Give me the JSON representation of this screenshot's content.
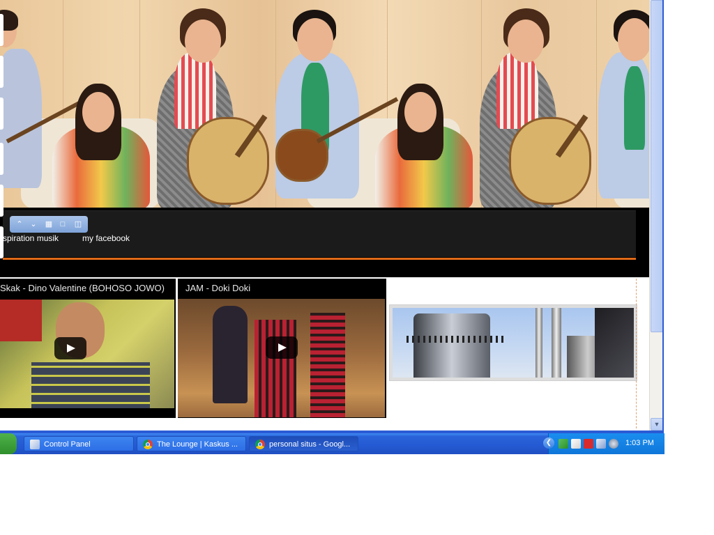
{
  "nav": {
    "links": [
      "spiration musik",
      "my facebook"
    ]
  },
  "edit_toolbar": {
    "icons": [
      "move-up-icon",
      "move-down-icon",
      "layout-grid-icon",
      "unlock-icon",
      "delete-icon"
    ]
  },
  "videos": [
    {
      "title": "Skak - Dino Valentine (BOHOSO JOWO)"
    },
    {
      "title": "JAM - Doki Doki"
    }
  ],
  "taskbar": {
    "tasks": [
      {
        "label": "Control Panel",
        "icon": "control-panel-icon"
      },
      {
        "label": "The Lounge | Kaskus ...",
        "icon": "chrome-icon"
      },
      {
        "label": "personal situs - Googl...",
        "icon": "chrome-icon"
      }
    ],
    "clock": "1:03 PM"
  },
  "colors": {
    "accent_orange": "#e06a18",
    "taskbar_blue": "#245ad3",
    "nav_bg": "#1b1b1b"
  }
}
